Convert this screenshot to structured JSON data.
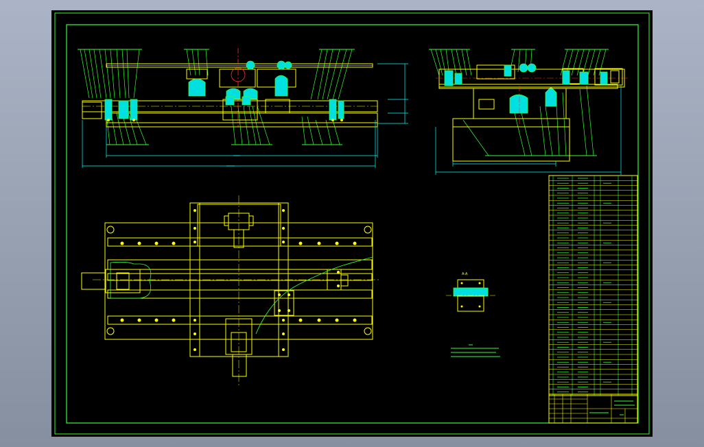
{
  "colors": {
    "viewport_top": "#aab4c6",
    "viewport_bottom": "#848e9e",
    "sheet": "#000000",
    "frame": "#33ff33",
    "line": "#ffff00",
    "dim": "#00ffff",
    "cyan_fill": "#00e0e0",
    "green": "#33ff33",
    "red": "#ff3333",
    "white": "#ffffff"
  },
  "section_label": "A-A"
}
